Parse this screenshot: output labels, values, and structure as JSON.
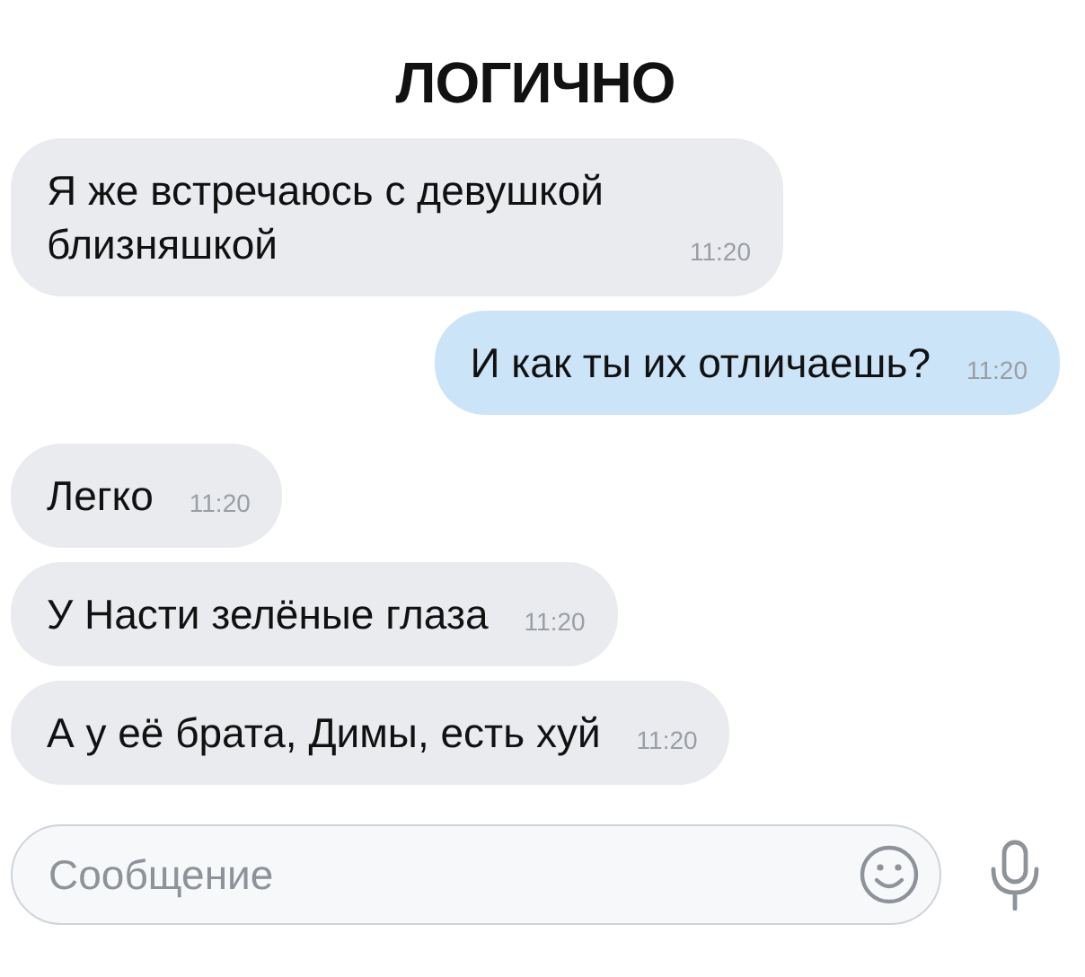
{
  "title": "ЛОГИЧНО",
  "messages": [
    {
      "kind": "incoming",
      "text": "Я же встречаюсь с девушкой близняшкой",
      "time": "11:20"
    },
    {
      "kind": "outgoing",
      "text": "И как ты их отличаешь?",
      "time": "11:20"
    },
    {
      "kind": "incoming",
      "text": "Легко",
      "time": "11:20"
    },
    {
      "kind": "incoming",
      "text": "У Насти зелёные глаза",
      "time": "11:20"
    },
    {
      "kind": "incoming",
      "text": "А у её брата, Димы, есть хуй",
      "time": "11:20"
    }
  ],
  "composer": {
    "placeholder": "Сообщение"
  }
}
